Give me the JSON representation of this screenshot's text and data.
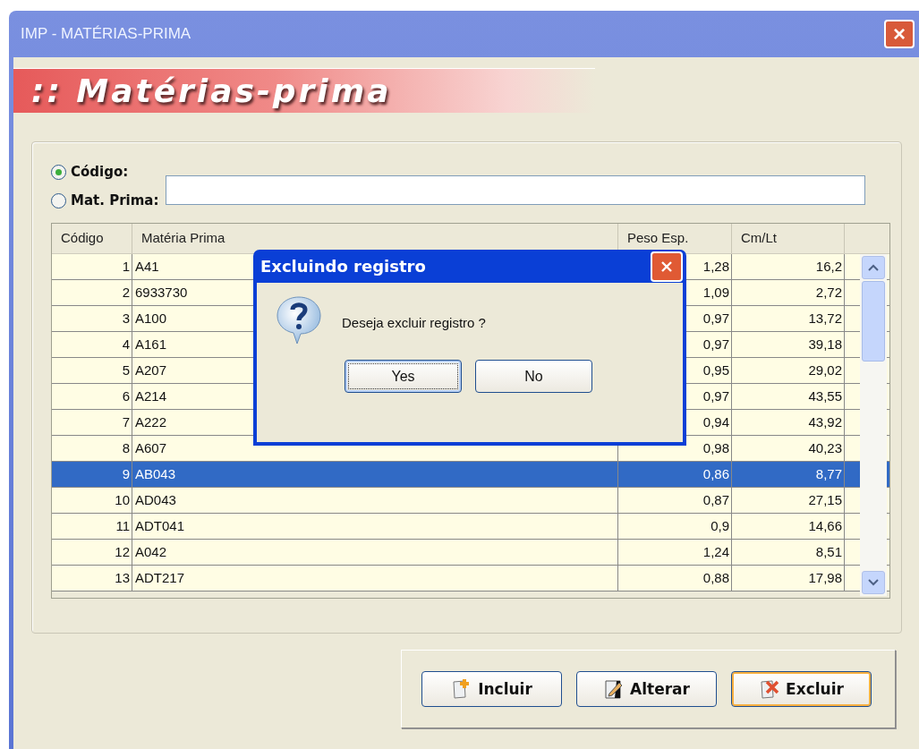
{
  "window": {
    "title": "IMP - MATÉRIAS-PRIMA",
    "close": "×"
  },
  "banner": {
    "title": ":: Matérias-prima"
  },
  "search": {
    "options": [
      {
        "label": "Código:",
        "selected": true
      },
      {
        "label": "Mat. Prima:",
        "selected": false
      }
    ]
  },
  "table": {
    "columns": [
      "Código",
      "Matéria Prima",
      "Peso Esp.",
      "Cm/Lt"
    ],
    "rows": [
      {
        "codigo": "1",
        "materia": "A41",
        "peso": "1,28",
        "cm": "16,2",
        "selected": false
      },
      {
        "codigo": "2",
        "materia": "6933730",
        "peso": "1,09",
        "cm": "2,72",
        "selected": false
      },
      {
        "codigo": "3",
        "materia": "A100",
        "peso": "0,97",
        "cm": "13,72",
        "selected": false
      },
      {
        "codigo": "4",
        "materia": "A161",
        "peso": "0,97",
        "cm": "39,18",
        "selected": false
      },
      {
        "codigo": "5",
        "materia": "A207",
        "peso": "0,95",
        "cm": "29,02",
        "selected": false
      },
      {
        "codigo": "6",
        "materia": "A214",
        "peso": "0,97",
        "cm": "43,55",
        "selected": false
      },
      {
        "codigo": "7",
        "materia": "A222",
        "peso": "0,94",
        "cm": "43,92",
        "selected": false
      },
      {
        "codigo": "8",
        "materia": "A607",
        "peso": "0,98",
        "cm": "40,23",
        "selected": false
      },
      {
        "codigo": "9",
        "materia": "AB043",
        "peso": "0,86",
        "cm": "8,77",
        "selected": true
      },
      {
        "codigo": "10",
        "materia": "AD043",
        "peso": "0,87",
        "cm": "27,15",
        "selected": false
      },
      {
        "codigo": "11",
        "materia": "ADT041",
        "peso": "0,9",
        "cm": "14,66",
        "selected": false
      },
      {
        "codigo": "12",
        "materia": "A042",
        "peso": "1,24",
        "cm": "8,51",
        "selected": false
      },
      {
        "codigo": "13",
        "materia": "ADT217",
        "peso": "0,88",
        "cm": "17,98",
        "selected": false
      }
    ]
  },
  "dialog": {
    "title": "Excluindo registro",
    "message": "Deseja excluir registro ?",
    "buttons": [
      {
        "label": "Yes",
        "focused": true
      },
      {
        "label": "No",
        "focused": false
      }
    ]
  },
  "buttons": [
    {
      "kind": "add",
      "label": "Incluir",
      "focused": false
    },
    {
      "kind": "edit",
      "label": "Alterar",
      "focused": false
    },
    {
      "kind": "delete",
      "label": "Excluir",
      "focused": true
    }
  ]
}
